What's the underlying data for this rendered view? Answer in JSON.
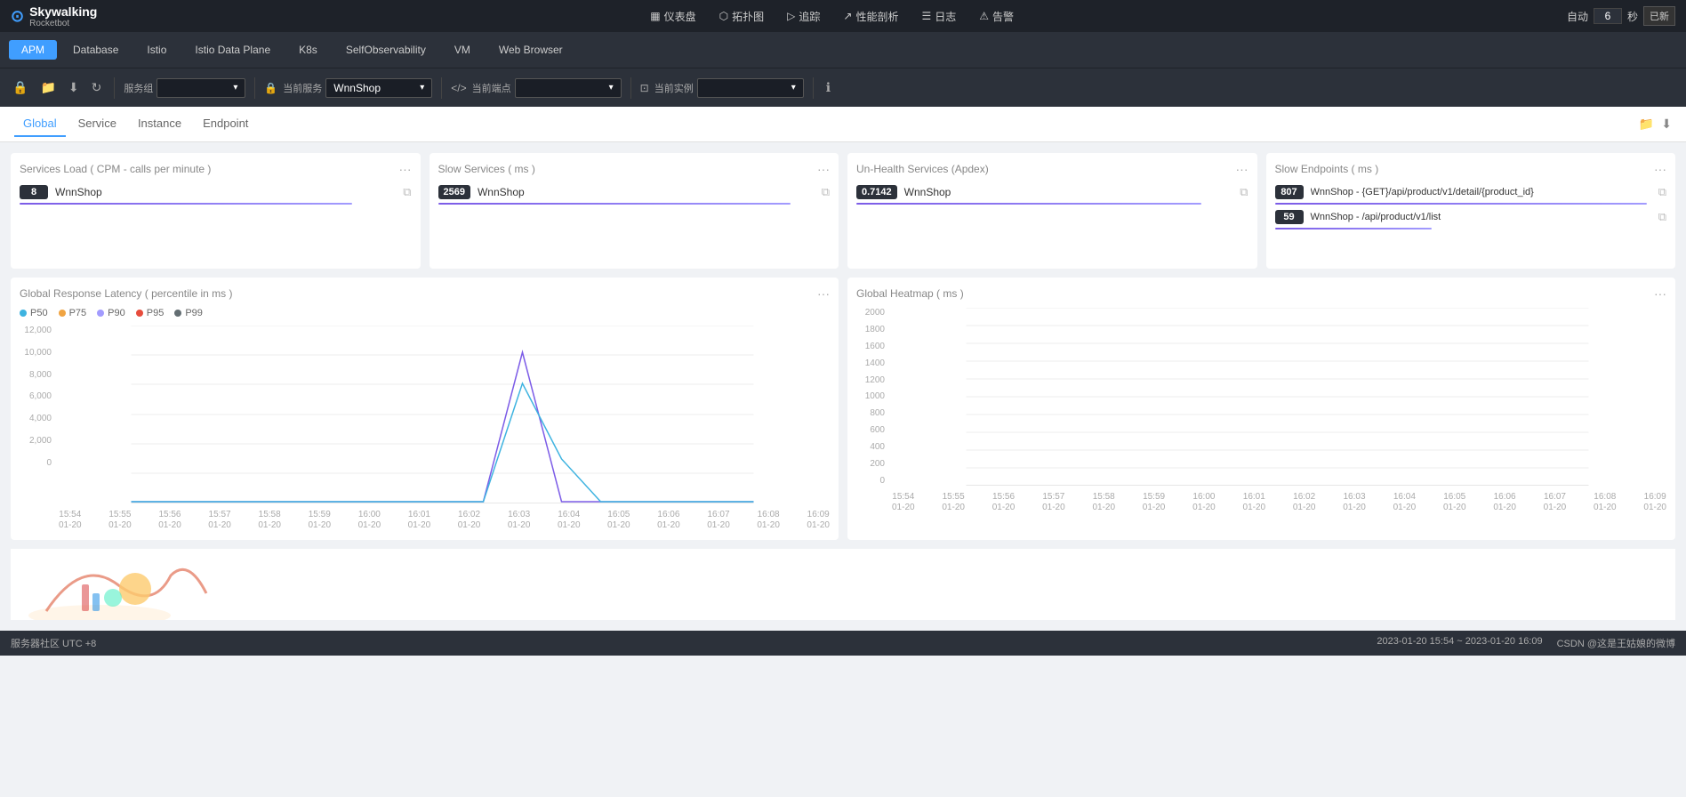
{
  "topNav": {
    "logo": "Skywalking",
    "logoSub": "Rocketbot",
    "tabs": [
      {
        "label": "仪表盘",
        "icon": "dashboard-icon"
      },
      {
        "label": "拓扑图",
        "icon": "topology-icon"
      },
      {
        "label": "追踪",
        "icon": "trace-icon"
      },
      {
        "label": "性能剖析",
        "icon": "performance-icon"
      },
      {
        "label": "日志",
        "icon": "log-icon"
      },
      {
        "label": "告警",
        "icon": "alert-icon"
      }
    ],
    "auto_label": "自动",
    "auto_value": "6",
    "sec_label": "秒",
    "refresh_label": "已新"
  },
  "secondaryNav": {
    "tabs": [
      "APM",
      "Database",
      "Istio",
      "Istio Data Plane",
      "K8s",
      "SelfObservability",
      "VM",
      "Web Browser"
    ],
    "activeTab": "APM"
  },
  "toolbar": {
    "serviceGroup_label": "服务组",
    "currentService_label": "当前服务",
    "currentService_value": "WnnShop",
    "currentEndpoint_label": "当前端点",
    "currentInstance_label": "当前实例",
    "info_icon": "ℹ"
  },
  "contentTabs": {
    "tabs": [
      "Global",
      "Service",
      "Instance",
      "Endpoint"
    ],
    "activeTab": "Global"
  },
  "cards": [
    {
      "title": "Services Load ( CPM - calls per minute )",
      "items": [
        {
          "badge": "8",
          "label": "WnnShop"
        }
      ]
    },
    {
      "title": "Slow Services ( ms )",
      "items": [
        {
          "badge": "2569",
          "label": "WnnShop"
        }
      ]
    },
    {
      "title": "Un-Health Services (Apdex)",
      "items": [
        {
          "badge": "0.7142",
          "label": "WnnShop"
        }
      ]
    },
    {
      "title": "Slow Endpoints ( ms )",
      "items": [
        {
          "badge": "807",
          "label": "WnnShop - {GET}/api/product/v1/detail/{product_id}"
        },
        {
          "badge": "59",
          "label": "WnnShop - /api/product/v1/list"
        }
      ]
    }
  ],
  "charts": [
    {
      "title": "Global Response Latency ( percentile in ms )",
      "legend": [
        {
          "label": "P50",
          "color": "#3eb3e0"
        },
        {
          "label": "P75",
          "color": "#f0a442"
        },
        {
          "label": "P90",
          "color": "#a29bfe"
        },
        {
          "label": "P95",
          "color": "#e74c3c"
        },
        {
          "label": "P99",
          "color": "#636e72"
        }
      ],
      "yLabels": [
        "12,000",
        "10,000",
        "8,000",
        "6,000",
        "4,000",
        "2,000",
        "0"
      ],
      "xLabels": [
        {
          "line1": "15:54",
          "line2": "01-20"
        },
        {
          "line1": "15:55",
          "line2": "01-20"
        },
        {
          "line1": "15:56",
          "line2": "01-20"
        },
        {
          "line1": "15:57",
          "line2": "01-20"
        },
        {
          "line1": "15:58",
          "line2": "01-20"
        },
        {
          "line1": "15:59",
          "line2": "01-20"
        },
        {
          "line1": "16:00",
          "line2": "01-20"
        },
        {
          "line1": "16:01",
          "line2": "01-20"
        },
        {
          "line1": "16:02",
          "line2": "01-20"
        },
        {
          "line1": "16:03",
          "line2": "01-20"
        },
        {
          "line1": "16:04",
          "line2": "01-20"
        },
        {
          "line1": "16:05",
          "line2": "01-20"
        },
        {
          "line1": "16:06",
          "line2": "01-20"
        },
        {
          "line1": "16:07",
          "line2": "01-20"
        },
        {
          "line1": "16:08",
          "line2": "01-20"
        },
        {
          "line1": "16:09",
          "line2": "01-20"
        }
      ]
    },
    {
      "title": "Global Heatmap ( ms )",
      "legend": [],
      "yLabels": [
        "2000",
        "1800",
        "1600",
        "1400",
        "1200",
        "1000",
        "800",
        "600",
        "400",
        "200",
        "0"
      ],
      "xLabels": [
        {
          "line1": "15:54",
          "line2": "01-20"
        },
        {
          "line1": "15:55",
          "line2": "01-20"
        },
        {
          "line1": "15:56",
          "line2": "01-20"
        },
        {
          "line1": "15:57",
          "line2": "01-20"
        },
        {
          "line1": "15:58",
          "line2": "01-20"
        },
        {
          "line1": "15:59",
          "line2": "01-20"
        },
        {
          "line1": "16:00",
          "line2": "01-20"
        },
        {
          "line1": "16:01",
          "line2": "01-20"
        },
        {
          "line1": "16:02",
          "line2": "01-20"
        },
        {
          "line1": "16:03",
          "line2": "01-20"
        },
        {
          "line1": "16:04",
          "line2": "01-20"
        },
        {
          "line1": "16:05",
          "line2": "01-20"
        },
        {
          "line1": "16:06",
          "line2": "01-20"
        },
        {
          "line1": "16:07",
          "line2": "01-20"
        },
        {
          "line1": "16:08",
          "line2": "01-20"
        },
        {
          "line1": "16:09",
          "line2": "01-20"
        }
      ]
    }
  ],
  "footer": {
    "left": "服务器社区 UTC +8",
    "timeRange": "2023-01-20 15:54 ~ 2023-01-20 16:09",
    "credit": "CSDN @这是王姑娘的微博"
  }
}
